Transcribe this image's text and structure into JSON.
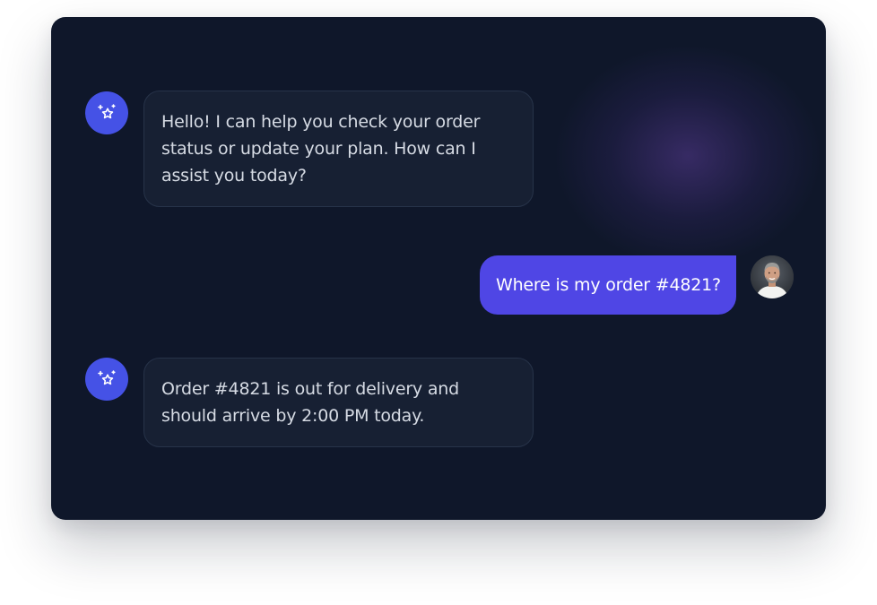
{
  "conversation": {
    "messages": [
      {
        "role": "assistant",
        "text": "Hello! I can help you check your order status or update your plan. How can I assist you today?"
      },
      {
        "role": "user",
        "text": "Where is my order #4821?"
      },
      {
        "role": "assistant",
        "text": "Order #4821 is out for delivery and should arrive by 2:00 PM today."
      }
    ]
  },
  "icons": {
    "assistant_avatar": "sparkle-star-icon",
    "user_avatar": "user-photo"
  },
  "colors": {
    "card_background": "#0f172a",
    "assistant_bubble": "#172033",
    "assistant_bubble_border": "#273349",
    "assistant_text": "#d6dbe4",
    "user_bubble": "#4f46e5",
    "user_text": "#ffffff",
    "avatar_accent": "#4552e6",
    "glow": "#6e46b4"
  }
}
